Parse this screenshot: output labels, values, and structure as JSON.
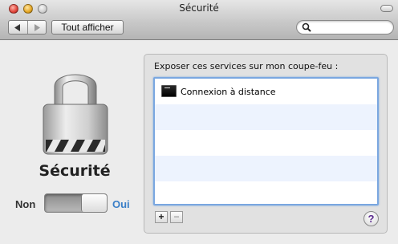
{
  "window": {
    "title": "Sécurité"
  },
  "toolbar": {
    "back_icon": "back-triangle-icon",
    "forward_icon": "forward-triangle-icon",
    "show_all_label": "Tout afficher",
    "search_placeholder": "",
    "search_value": ""
  },
  "pane": {
    "title": "Sécurité",
    "switch": {
      "off_label": "Non",
      "on_label": "Oui",
      "state": "on"
    }
  },
  "firewall": {
    "label": "Exposer ces services sur mon coupe-feu :",
    "services": [
      "Connexion à distance"
    ],
    "add_label": "+",
    "remove_label": "−",
    "help_label": "?"
  },
  "colors": {
    "selection_border": "#7aa7e0",
    "on_label": "#3a7fc8",
    "help_glyph": "#5b2b8e"
  }
}
